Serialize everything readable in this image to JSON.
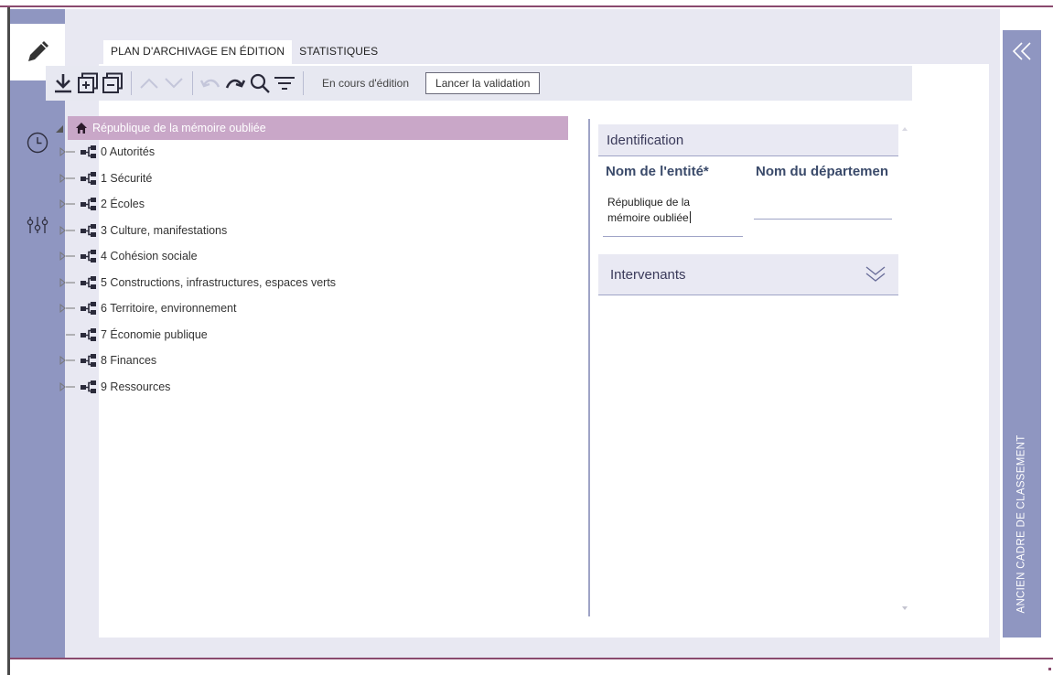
{
  "tabs": [
    {
      "label": "PLAN D'ARCHIVAGE EN ÉDITION",
      "active": true
    },
    {
      "label": "STATISTIQUES",
      "active": false
    }
  ],
  "toolbar": {
    "icons": [
      "download-icon",
      "expand-all-icon",
      "collapse-all-icon",
      "move-up-icon",
      "move-down-icon",
      "undo-icon",
      "redo-icon",
      "search-icon",
      "filter-icon"
    ],
    "status": "En cours d'édition",
    "launch_label": "Lancer la validation"
  },
  "tree": {
    "root": {
      "label": "République de la mémoire oubliée"
    },
    "items": [
      {
        "label": "0 Autorités",
        "expandable": true
      },
      {
        "label": "1 Sécurité",
        "expandable": true
      },
      {
        "label": "2 Écoles",
        "expandable": true
      },
      {
        "label": "3 Culture, manifestations",
        "expandable": true
      },
      {
        "label": "4 Cohésion sociale",
        "expandable": true
      },
      {
        "label": "5 Constructions, infrastructures, espaces verts",
        "expandable": true
      },
      {
        "label": "6 Territoire, environnement",
        "expandable": true
      },
      {
        "label": "7 Économie publique",
        "expandable": false
      },
      {
        "label": "8 Finances",
        "expandable": true
      },
      {
        "label": "9 Ressources",
        "expandable": true
      }
    ]
  },
  "panel": {
    "identification": {
      "title": "Identification",
      "entity_label": "Nom de l'entité*",
      "entity_value_line1": "République de la",
      "entity_value_line2": "mémoire oubliée",
      "department_label": "Nom du départemen"
    },
    "intervenants": {
      "title": "Intervenants"
    }
  },
  "right_rail": {
    "label": "ANCIEN CADRE DE CLASSEMENT"
  },
  "colors": {
    "rail": "#8f96c1",
    "selection": "#c9a7c8",
    "accent_border": "#8a4a6e"
  }
}
